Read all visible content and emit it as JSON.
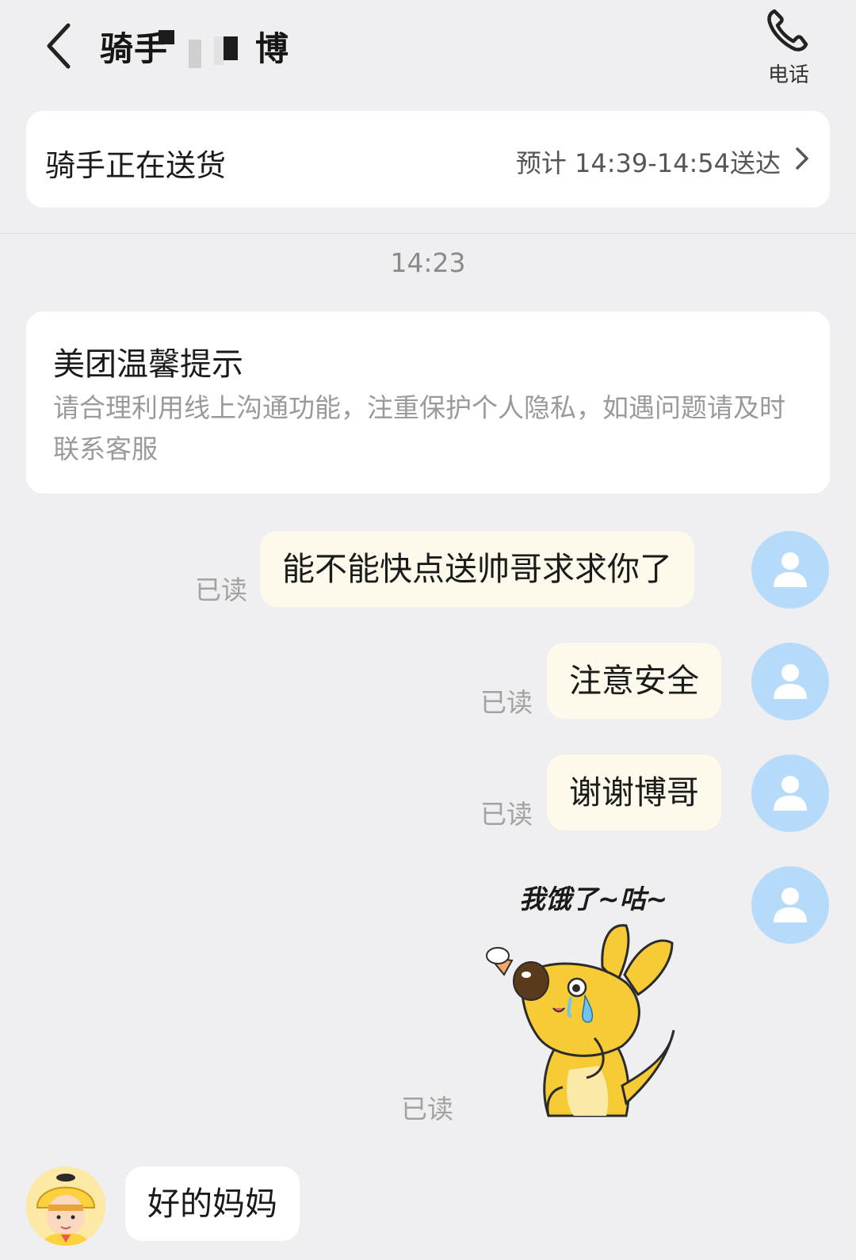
{
  "header": {
    "title_prefix": "骑手",
    "title_suffix": "博",
    "phone_label": "电话"
  },
  "status": {
    "text": "骑手正在送货",
    "eta": "预计 14:39-14:54送达"
  },
  "chat": {
    "timestamp": "14:23",
    "tip": {
      "title": "美团温馨提示",
      "body": "请合理利用线上沟通功能，注重保护个人隐私，如遇问题请及时联系客服"
    },
    "messages": [
      {
        "text": "能不能快点送帅哥求求你了",
        "status": "已读"
      },
      {
        "text": "注意安全",
        "status": "已读"
      },
      {
        "text": "谢谢博哥",
        "status": "已读"
      }
    ],
    "sticker": {
      "caption": "我饿了~咕~",
      "status": "已读"
    },
    "reply": {
      "text": "好的妈妈"
    }
  },
  "colors": {
    "background": "#efeff1",
    "outgoing_bubble": "#fdf9eb",
    "avatar": "#b6dbfa",
    "rider_helmet": "#fdd13d"
  },
  "icons": {
    "back": "chevron-left-icon",
    "phone": "phone-icon",
    "eta_arrow": "chevron-right-icon",
    "user_avatar": "user-icon"
  }
}
